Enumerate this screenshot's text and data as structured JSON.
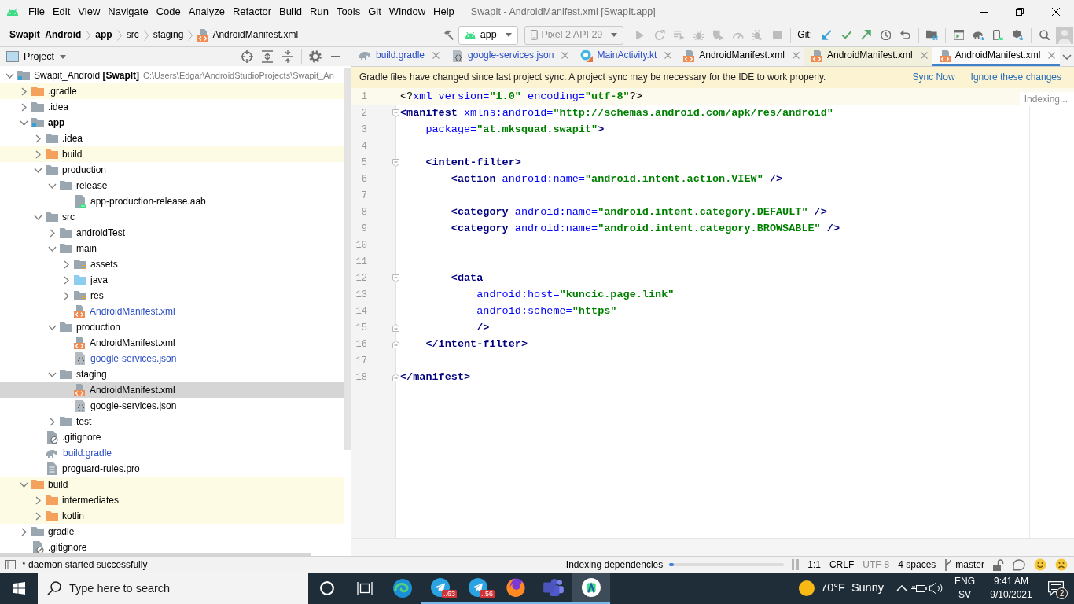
{
  "window": {
    "title": "SwapIt - AndroidManifest.xml [SwapIt.app]"
  },
  "menu": [
    "File",
    "Edit",
    "View",
    "Navigate",
    "Code",
    "Analyze",
    "Refactor",
    "Build",
    "Run",
    "Tools",
    "Git",
    "Window",
    "Help"
  ],
  "breadcrumbs": [
    {
      "kind": "project",
      "label": "Swapit_Android"
    },
    {
      "kind": "module",
      "label": "app"
    },
    {
      "kind": "folder",
      "label": "src"
    },
    {
      "kind": "folder",
      "label": "staging"
    },
    {
      "kind": "xml-file",
      "label": "AndroidManifest.xml"
    }
  ],
  "toolbar": [
    {
      "kind": "build",
      "disabled": false
    },
    {
      "kind": "config-select",
      "label": "app",
      "disabled": false
    },
    {
      "kind": "device-select",
      "label": "Pixel 2 API 29",
      "disabled": true
    },
    {
      "kind": "run",
      "disabled": true
    },
    {
      "kind": "apply-restart",
      "disabled": true
    },
    {
      "kind": "apply-code",
      "disabled": true
    },
    {
      "kind": "debug",
      "disabled": true
    },
    {
      "kind": "coverage",
      "disabled": true
    },
    {
      "kind": "profile",
      "disabled": true
    },
    {
      "kind": "attach-debugger",
      "disabled": true
    },
    {
      "kind": "stop",
      "disabled": true
    },
    {
      "kind": "separator"
    },
    {
      "kind": "label",
      "label": "Git:"
    },
    {
      "kind": "git-update",
      "disabled": false
    },
    {
      "kind": "git-commit",
      "disabled": false
    },
    {
      "kind": "git-push",
      "disabled": false
    },
    {
      "kind": "git-history",
      "disabled": false
    },
    {
      "kind": "git-rollback",
      "disabled": false
    },
    {
      "kind": "separator"
    },
    {
      "kind": "project-structure",
      "disabled": false
    },
    {
      "kind": "separator"
    },
    {
      "kind": "run-window",
      "disabled": false
    },
    {
      "kind": "gradle-sync",
      "disabled": false
    },
    {
      "kind": "device-manager",
      "disabled": false
    },
    {
      "kind": "sdk-manager",
      "disabled": false
    },
    {
      "kind": "separator"
    },
    {
      "kind": "search",
      "disabled": false
    },
    {
      "kind": "avatar"
    }
  ],
  "project_panel": {
    "title": "Project",
    "tree": [
      {
        "kind": "project",
        "label": "Swapit_Android **[SwapIt]**",
        "path": "C:\\Users\\Edgar\\AndroidStudioProjects\\Swapit_An",
        "expanded": true,
        "selected": false,
        "modified": false,
        "children": [
          {
            "kind": "excluded-folder",
            "label": ".gradle",
            "expanded": false,
            "selected": false,
            "modified": false
          },
          {
            "kind": "folder",
            "label": ".idea",
            "expanded": false,
            "selected": false,
            "modified": false
          },
          {
            "kind": "module",
            "label": "app",
            "expanded": true,
            "selected": false,
            "modified": false,
            "children": [
              {
                "kind": "folder",
                "label": ".idea",
                "expanded": false,
                "selected": false,
                "modified": false
              },
              {
                "kind": "excluded-folder",
                "label": "build",
                "expanded": false,
                "selected": false,
                "modified": false
              },
              {
                "kind": "folder",
                "label": "production",
                "expanded": true,
                "selected": false,
                "modified": false,
                "children": [
                  {
                    "kind": "folder",
                    "label": "release",
                    "expanded": true,
                    "selected": false,
                    "modified": false,
                    "children": [
                      {
                        "kind": "aab-file",
                        "label": "app-production-release.aab",
                        "selected": false,
                        "modified": false
                      }
                    ]
                  }
                ]
              },
              {
                "kind": "folder",
                "label": "src",
                "expanded": true,
                "selected": false,
                "modified": false,
                "children": [
                  {
                    "kind": "folder",
                    "label": "androidTest",
                    "expanded": false,
                    "selected": false,
                    "modified": false
                  },
                  {
                    "kind": "folder",
                    "label": "main",
                    "expanded": true,
                    "selected": false,
                    "modified": false,
                    "children": [
                      {
                        "kind": "resource-folder",
                        "label": "assets",
                        "expanded": false,
                        "selected": false,
                        "modified": false
                      },
                      {
                        "kind": "source-folder",
                        "label": "java",
                        "expanded": false,
                        "selected": false,
                        "modified": false
                      },
                      {
                        "kind": "resource-folder",
                        "label": "res",
                        "expanded": false,
                        "selected": false,
                        "modified": false
                      },
                      {
                        "kind": "xml-file",
                        "label": "AndroidManifest.xml",
                        "selected": false,
                        "modified": true
                      }
                    ]
                  },
                  {
                    "kind": "folder",
                    "label": "production",
                    "expanded": true,
                    "selected": false,
                    "modified": false,
                    "children": [
                      {
                        "kind": "xml-file",
                        "label": "AndroidManifest.xml",
                        "selected": false,
                        "modified": false
                      },
                      {
                        "kind": "json-file",
                        "label": "google-services.json",
                        "selected": false,
                        "modified": true
                      }
                    ]
                  },
                  {
                    "kind": "folder",
                    "label": "staging",
                    "expanded": true,
                    "selected": false,
                    "modified": false,
                    "children": [
                      {
                        "kind": "xml-file",
                        "label": "AndroidManifest.xml",
                        "selected": true,
                        "modified": false
                      },
                      {
                        "kind": "json-file",
                        "label": "google-services.json",
                        "selected": false,
                        "modified": false
                      }
                    ]
                  },
                  {
                    "kind": "folder",
                    "label": "test",
                    "expanded": false,
                    "selected": false,
                    "modified": false
                  }
                ]
              },
              {
                "kind": "ignore-file",
                "label": ".gitignore",
                "selected": false,
                "modified": false
              },
              {
                "kind": "gradle-file",
                "label": "build.gradle",
                "selected": false,
                "modified": true
              },
              {
                "kind": "text-file",
                "label": "proguard-rules.pro",
                "selected": false,
                "modified": false
              }
            ]
          },
          {
            "kind": "excluded-folder",
            "label": "build",
            "expanded": true,
            "selected": false,
            "modified": false,
            "children": [
              {
                "kind": "excluded-folder",
                "label": "intermediates",
                "expanded": false,
                "selected": false,
                "modified": false
              },
              {
                "kind": "excluded-folder",
                "label": "kotlin",
                "expanded": false,
                "selected": false,
                "modified": false
              }
            ]
          },
          {
            "kind": "folder",
            "label": "gradle",
            "expanded": false,
            "selected": false,
            "modified": false
          },
          {
            "kind": "ignore-file",
            "label": ".gitignore",
            "selected": false,
            "modified": false
          }
        ]
      }
    ]
  },
  "editor_tabs": [
    {
      "kind": "gradle-file",
      "label": "build.gradle",
      "modified": true,
      "tinted": false,
      "selected": false
    },
    {
      "kind": "json-file",
      "label": "google-services.json",
      "modified": true,
      "tinted": false,
      "selected": false
    },
    {
      "kind": "kotlin-file",
      "label": "MainActivity.kt",
      "modified": true,
      "tinted": false,
      "selected": false
    },
    {
      "kind": "xml-file",
      "label": "AndroidManifest.xml",
      "modified": false,
      "tinted": false,
      "selected": false
    },
    {
      "kind": "xml-file",
      "label": "AndroidManifest.xml",
      "modified": false,
      "tinted": true,
      "selected": false
    },
    {
      "kind": "xml-file",
      "label": "AndroidManifest.xml",
      "modified": false,
      "tinted": false,
      "selected": true
    }
  ],
  "notification": {
    "message": "Gradle files have changed since last project sync. A project sync may be necessary for the IDE to work properly.",
    "actions": [
      "Sync Now",
      "Ignore these changes"
    ]
  },
  "editor": {
    "status": "Indexing...",
    "lines": [
      {
        "number": "1",
        "kind": "plain",
        "current": true,
        "tokens": [
          {
            "kind": "punct",
            "text": "<?"
          },
          {
            "kind": "attr",
            "text": "xml version="
          },
          {
            "kind": "value",
            "text": "\"1.0\""
          },
          {
            "kind": "attr",
            "text": " encoding="
          },
          {
            "kind": "value",
            "text": "\"utf-8\""
          },
          {
            "kind": "punct",
            "text": "?>"
          }
        ]
      },
      {
        "number": "2",
        "kind": "fold-start",
        "current": false,
        "tokens": [
          {
            "kind": "tag",
            "text": "<manifest"
          },
          {
            "kind": "attr",
            "text": " xmlns:android="
          },
          {
            "kind": "value",
            "text": "\"http://schemas.android.com/apk/res/android\""
          }
        ]
      },
      {
        "number": "3",
        "kind": "plain",
        "current": false,
        "tokens": [
          {
            "kind": "attr",
            "text": "    package="
          },
          {
            "kind": "value",
            "text": "\"at.mksquad.swapit\""
          },
          {
            "kind": "tag",
            "text": ">"
          }
        ]
      },
      {
        "number": "4",
        "kind": "plain",
        "current": false
      },
      {
        "number": "5",
        "kind": "fold-start",
        "current": false,
        "tokens": [
          {
            "kind": "tag",
            "text": "    <intent-filter>"
          }
        ]
      },
      {
        "number": "6",
        "kind": "plain",
        "current": false,
        "tokens": [
          {
            "kind": "tag",
            "text": "        <action"
          },
          {
            "kind": "attr",
            "text": " android:name="
          },
          {
            "kind": "value",
            "text": "\"android.intent.action.VIEW\""
          },
          {
            "kind": "tag",
            "text": " />"
          }
        ]
      },
      {
        "number": "7",
        "kind": "plain",
        "current": false
      },
      {
        "number": "8",
        "kind": "plain",
        "current": false,
        "tokens": [
          {
            "kind": "tag",
            "text": "        <category"
          },
          {
            "kind": "attr",
            "text": " android:name="
          },
          {
            "kind": "value",
            "text": "\"android.intent.category.DEFAULT\""
          },
          {
            "kind": "tag",
            "text": " />"
          }
        ]
      },
      {
        "number": "9",
        "kind": "plain",
        "current": false,
        "tokens": [
          {
            "kind": "tag",
            "text": "        <category"
          },
          {
            "kind": "attr",
            "text": " android:name="
          },
          {
            "kind": "value",
            "text": "\"android.intent.category.BROWSABLE\""
          },
          {
            "kind": "tag",
            "text": " />"
          }
        ]
      },
      {
        "number": "10",
        "kind": "plain",
        "current": false
      },
      {
        "number": "11",
        "kind": "plain",
        "current": false
      },
      {
        "number": "12",
        "kind": "fold-start",
        "current": false,
        "tokens": [
          {
            "kind": "tag",
            "text": "        <data"
          }
        ]
      },
      {
        "number": "13",
        "kind": "plain",
        "current": false,
        "tokens": [
          {
            "kind": "attr",
            "text": "            android:host="
          },
          {
            "kind": "value",
            "text": "\"kuncic.page.link\""
          }
        ]
      },
      {
        "number": "14",
        "kind": "plain",
        "current": false,
        "tokens": [
          {
            "kind": "attr",
            "text": "            android:scheme="
          },
          {
            "kind": "value",
            "text": "\"https\""
          }
        ]
      },
      {
        "number": "15",
        "kind": "fold-end",
        "current": false,
        "tokens": [
          {
            "kind": "tag",
            "text": "            />"
          }
        ]
      },
      {
        "number": "16",
        "kind": "fold-end",
        "current": false,
        "tokens": [
          {
            "kind": "tag",
            "text": "    </intent-filter>"
          }
        ]
      },
      {
        "number": "17",
        "kind": "plain",
        "current": false
      },
      {
        "number": "18",
        "kind": "fold-end",
        "current": false,
        "tokens": [
          {
            "kind": "tag",
            "text": "</manifest>"
          }
        ]
      }
    ]
  },
  "status_bar": {
    "message": "* daemon started successfully",
    "task": "Indexing dependencies",
    "progress": {
      "level": 0.04
    },
    "items": [
      {
        "text": "1:1",
        "disabled": false
      },
      {
        "text": "CRLF",
        "disabled": false
      },
      {
        "text": "UTF-8",
        "disabled": true
      },
      {
        "text": "4 spaces",
        "disabled": false
      }
    ],
    "branch": "master"
  },
  "taskbar": {
    "search": {
      "placeholder": "Type here to search"
    },
    "apps": [
      {
        "kind": "edge",
        "running": false,
        "active": false
      },
      {
        "kind": "telegram",
        "badge": "..63",
        "running": true,
        "active": false
      },
      {
        "kind": "telegram",
        "badge": "..56",
        "running": true,
        "active": false
      },
      {
        "kind": "firefox",
        "running": true,
        "active": false
      },
      {
        "kind": "teams",
        "running": true,
        "active": false
      },
      {
        "kind": "android-studio",
        "running": true,
        "active": true
      }
    ],
    "weather": {
      "temperature": "70°F",
      "condition": "Sunny"
    },
    "language": [
      "ENG",
      "SV"
    ],
    "time": "9:41 AM",
    "date": "9/10/2021",
    "notification_count": "2"
  }
}
